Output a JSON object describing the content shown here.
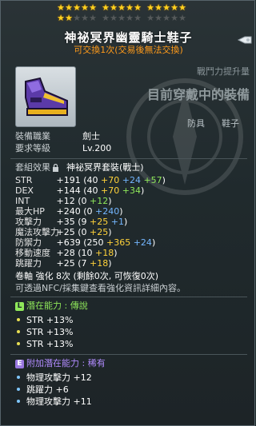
{
  "stars": {
    "row1": [
      true,
      true,
      true,
      true,
      true,
      true,
      true,
      true,
      true,
      true,
      true,
      true,
      true,
      true,
      true
    ],
    "row2": [
      true,
      true,
      false,
      false,
      false,
      false,
      false,
      false,
      false,
      false,
      false,
      false,
      false,
      false,
      false
    ]
  },
  "item": {
    "name": "神祕冥界幽靈騎士鞋子",
    "trade_note": "可交換1次(交易後無法交換)",
    "icon": "purple-gold-boots-icon"
  },
  "header": {
    "power_label": "戰鬥力提升量",
    "equipped_text": "目前穿戴中的裝備"
  },
  "tags": [
    "防具",
    "鞋子"
  ],
  "info": {
    "job_label": "裝備職業",
    "job_value": "劍士",
    "level_label": "要求等級",
    "level_value": "Lv.200",
    "set_label": "套組效果",
    "set_value": "神祕冥界套裝(戰士)"
  },
  "stats": [
    {
      "name": "STR",
      "total": "+191",
      "open": " (40 ",
      "a": "+70",
      "b": " +24",
      "c": " +57",
      "close": ")"
    },
    {
      "name": "DEX",
      "total": "+144",
      "open": " (40 ",
      "a": "+70",
      "b": "",
      "c": " +34",
      "close": ")"
    },
    {
      "name": "INT",
      "total": "+12",
      "open": " (0 ",
      "a": "",
      "b": "",
      "c": "+12",
      "close": ")"
    },
    {
      "name": "最大HP",
      "total": "+240",
      "open": " (0 ",
      "a": "",
      "b": "+240",
      "c": "",
      "close": ")"
    },
    {
      "name": "攻擊力",
      "total": "+35",
      "open": " (9 ",
      "a": "+25",
      "b": " +1",
      "c": "",
      "close": ")"
    },
    {
      "name": "魔法攻擊力",
      "total": "+25",
      "open": " (0 ",
      "a": "+25",
      "b": "",
      "c": "",
      "close": ")"
    },
    {
      "name": "防禦力",
      "total": "+639",
      "open": " (250 ",
      "a": "+365",
      "b": " +24",
      "c": "",
      "close": ")"
    },
    {
      "name": "移動速度",
      "total": "+28",
      "open": " (10 ",
      "a": "+18",
      "b": "",
      "c": "",
      "close": ")"
    },
    {
      "name": "跳躍力",
      "total": "+25",
      "open": " (7 ",
      "a": "+18",
      "b": "",
      "c": "",
      "close": ")"
    }
  ],
  "enhance": {
    "scroll_line": "卷軸 強化 8次 (剩餘0次, 可恢復0次)",
    "note_line": "可透過NFC/採集鍵查看強化資訊詳細內容。"
  },
  "potential": {
    "badge": "L",
    "title": "潛在能力 : 傳說",
    "lines": [
      "STR +13%",
      "STR +13%",
      "STR +13%"
    ]
  },
  "additional": {
    "badge": "E",
    "title": "附加潛在能力 : 稀有",
    "lines": [
      "物理攻擊力 +12",
      "跳躍力 +6",
      "物理攻擊力 +11"
    ]
  }
}
